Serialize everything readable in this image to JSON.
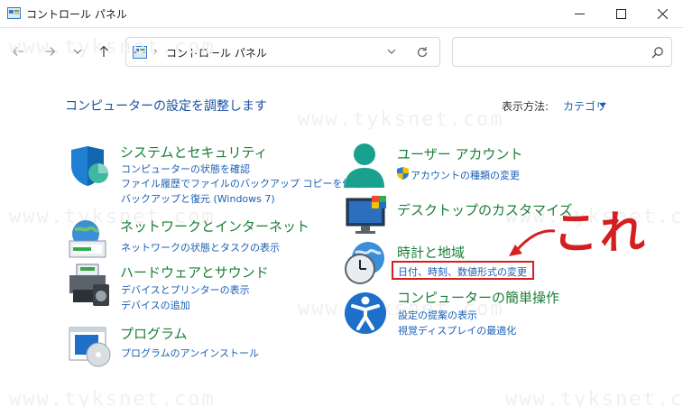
{
  "window": {
    "title": "コントロール パネル"
  },
  "address": {
    "crumb": "コントロール パネル",
    "separator": "›"
  },
  "search": {
    "placeholder": ""
  },
  "header": {
    "title": "コンピューターの設定を調整します",
    "view_by_label": "表示方法:",
    "view_by_value": "カテゴリ"
  },
  "categories": {
    "system": {
      "title": "システムとセキュリティ",
      "links": [
        "コンピューターの状態を確認",
        "ファイル履歴でファイルのバックアップ コピーを保存",
        "バックアップと復元 (Windows 7)"
      ]
    },
    "network": {
      "title": "ネットワークとインターネット",
      "links": [
        "ネットワークの状態とタスクの表示"
      ]
    },
    "hardware": {
      "title": "ハードウェアとサウンド",
      "links": [
        "デバイスとプリンターの表示",
        "デバイスの追加"
      ]
    },
    "programs": {
      "title": "プログラム",
      "links": [
        "プログラムのアンインストール"
      ]
    },
    "user": {
      "title": "ユーザー アカウント",
      "links": [
        "アカウントの種類の変更"
      ]
    },
    "appearance": {
      "title": "デスクトップのカスタマイズ",
      "links": []
    },
    "clock": {
      "title": "時計と地域",
      "links": [
        "日付、時刻、数値形式の変更"
      ]
    },
    "access": {
      "title": "コンピューターの簡単操作",
      "links": [
        "設定の提案の表示",
        "視覚ディスプレイの最適化"
      ]
    }
  },
  "annotation": {
    "text": "これ"
  },
  "watermark": {
    "text": "www.tyksnet.com"
  },
  "colors": {
    "link": "#1a5fb4",
    "category": "#1a7f37",
    "highlight": "#d42020"
  }
}
